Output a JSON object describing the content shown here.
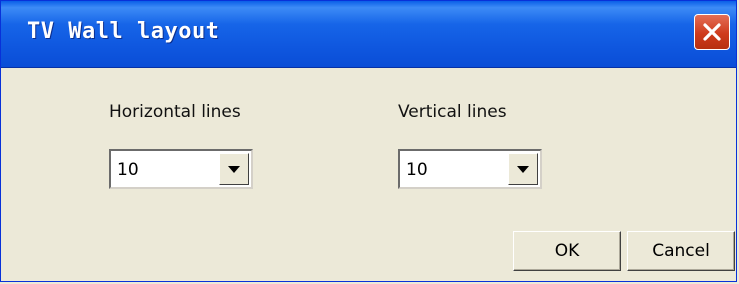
{
  "dialog": {
    "title": "TV Wall layout",
    "close_icon": "close-icon"
  },
  "horizontal": {
    "label": "Horizontal lines",
    "value": "10"
  },
  "vertical": {
    "label": "Vertical lines",
    "value": "10"
  },
  "buttons": {
    "ok": "OK",
    "cancel": "Cancel"
  },
  "colors": {
    "titlebar": "#0f57df",
    "close_button": "#cf3b1c",
    "dialog_background": "#ece9d8"
  }
}
